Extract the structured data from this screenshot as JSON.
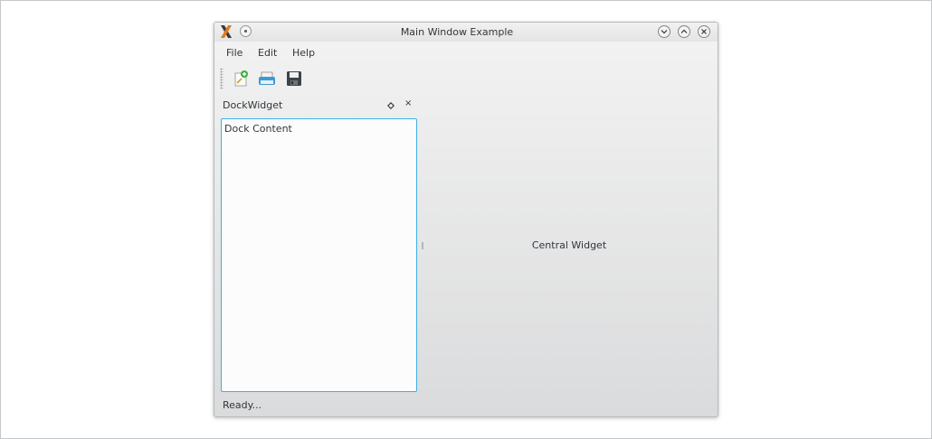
{
  "window": {
    "title": "Main Window Example"
  },
  "icons": {
    "app": "x-app-icon",
    "pin": "pin-icon",
    "minimize": "chevron-down-icon",
    "maximize": "chevron-up-icon",
    "close": "close-icon"
  },
  "menubar": {
    "items": [
      "File",
      "Edit",
      "Help"
    ]
  },
  "toolbar": {
    "buttons": [
      "new-file-icon",
      "print-icon",
      "save-icon"
    ]
  },
  "dock": {
    "title": "DockWidget",
    "float_icon": "float-icon",
    "close_glyph": "×",
    "content": "Dock Content"
  },
  "central": {
    "label": "Central Widget"
  },
  "statusbar": {
    "text": "Ready..."
  },
  "colors": {
    "accent": "#3daee9",
    "text": "#31363b"
  }
}
